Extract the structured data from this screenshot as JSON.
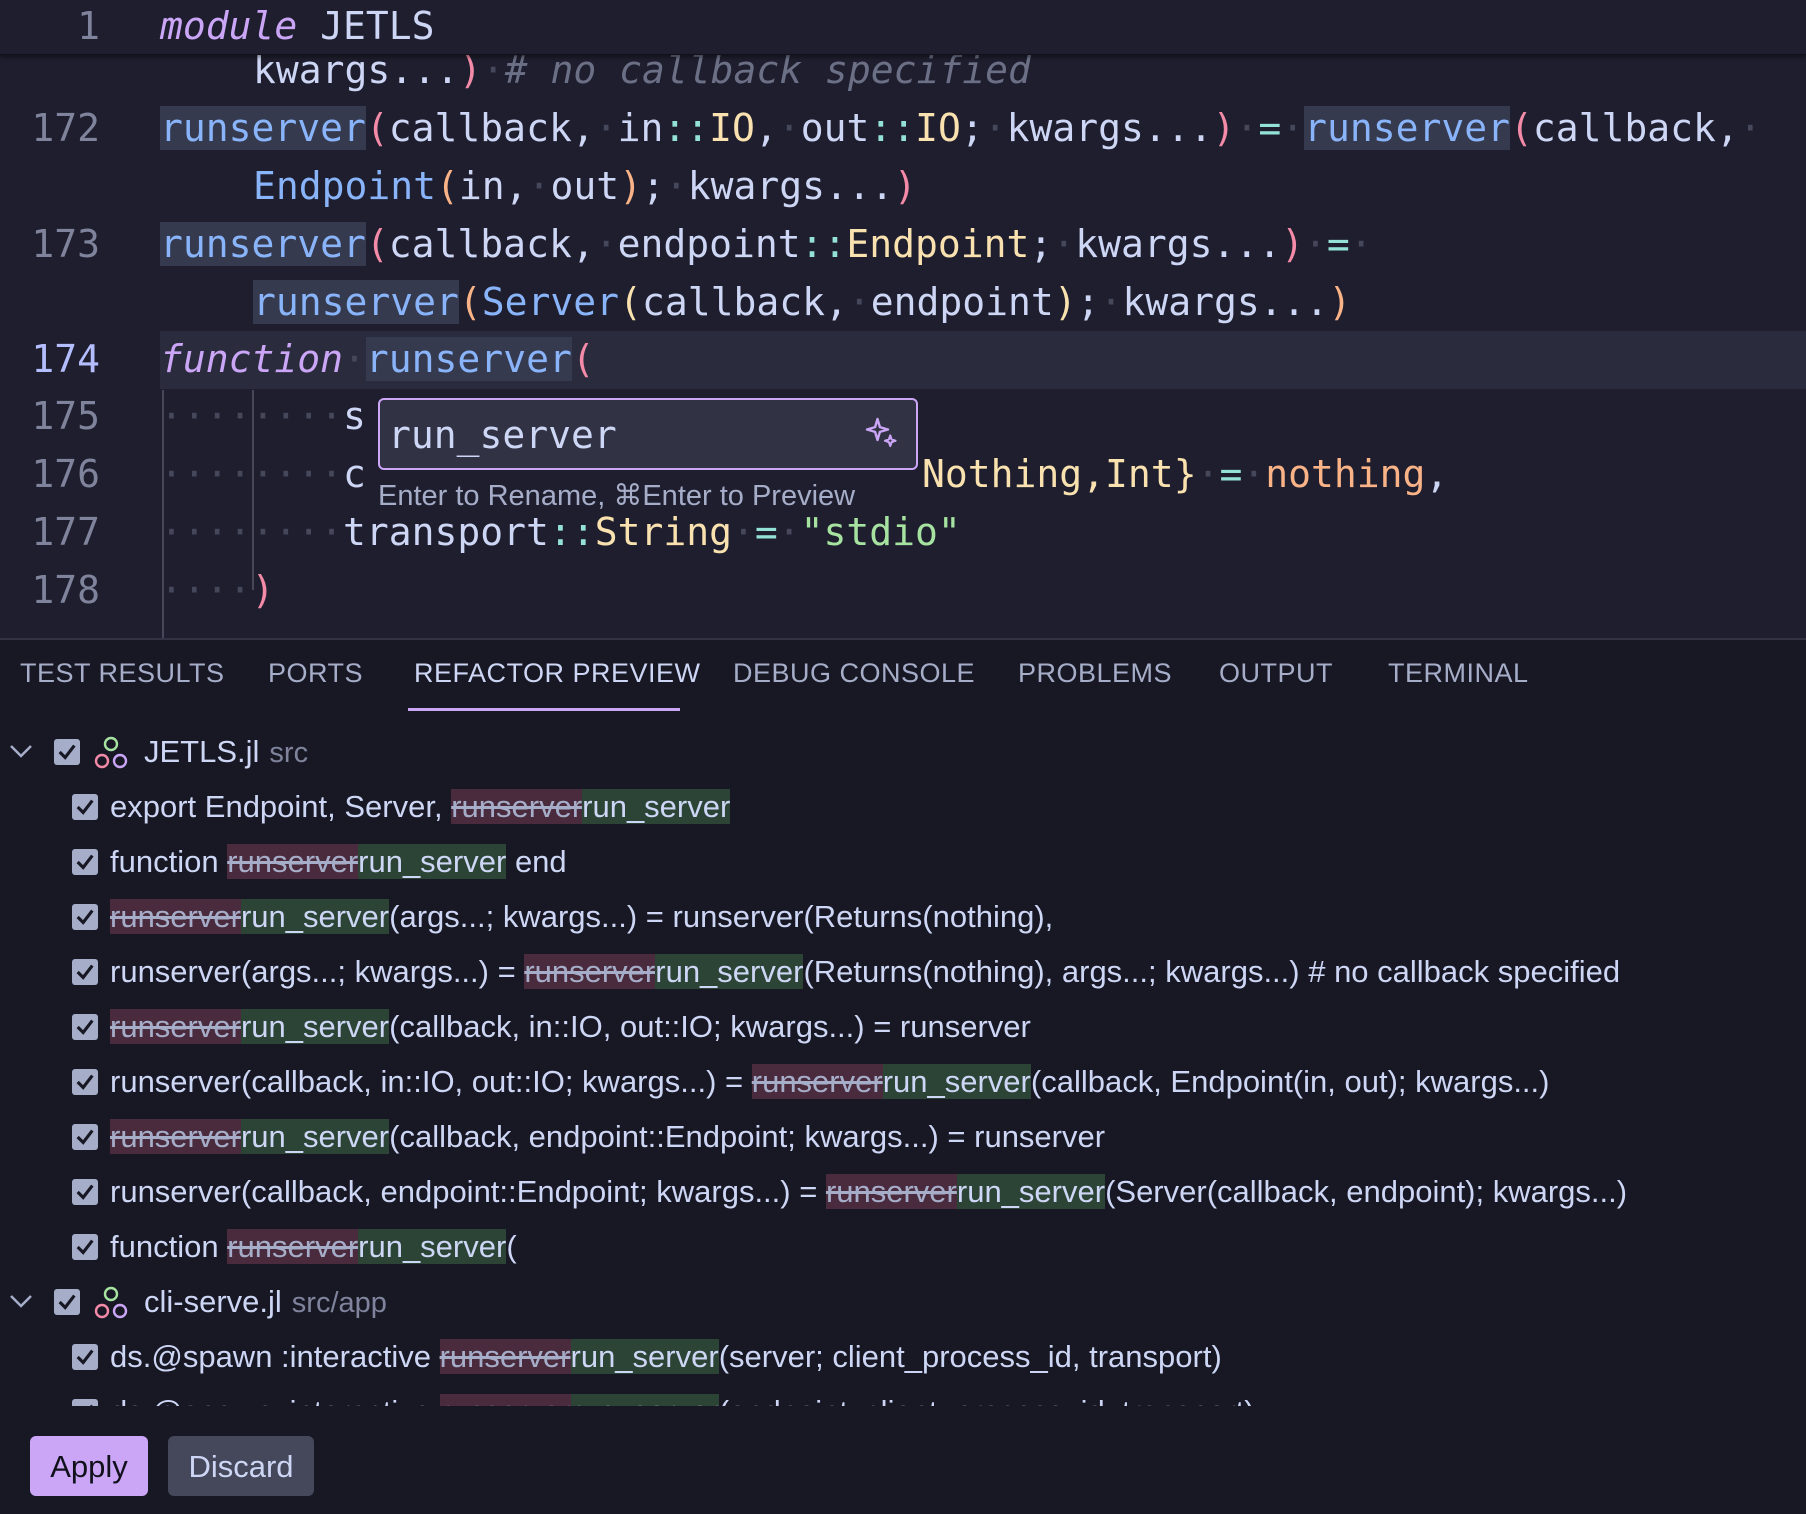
{
  "editor": {
    "sticky_line_number": "1",
    "sticky_keyword": "module",
    "sticky_name": "JETLS",
    "lines": {
      "l0_text": "kwargs...",
      "l0_comment": "# no callback specified",
      "l172_num": "172",
      "l173_num": "173",
      "l174_num": "174",
      "l175_num": "175",
      "l176_num": "176",
      "l177_num": "177",
      "l178_num": "178",
      "fn_name": "runserver",
      "kw_function": "function",
      "callback": "callback",
      "in": "in",
      "out": "out",
      "io": "IO",
      "kwargs": "kwargs...",
      "endpoint_ty": "Endpoint",
      "endpoint": "endpoint",
      "server_ty": "Server",
      "l175_s": "s",
      "l176_c": "c",
      "l176_rest_ty1": "Nothing",
      "l176_rest_ty2": "Int",
      "l176_nothing": "nothing",
      "l177_transport": "transport",
      "l177_type": "String",
      "l177_str": "\"stdio\"",
      "l178_paren": ")"
    }
  },
  "rename": {
    "value": "run_server",
    "hint": "Enter to Rename, ⌘Enter to Preview"
  },
  "panel": {
    "tabs": [
      "TEST RESULTS",
      "PORTS",
      "REFACTOR PREVIEW",
      "DEBUG CONSOLE",
      "PROBLEMS",
      "OUTPUT",
      "TERMINAL"
    ],
    "files": [
      {
        "name": "JETLS.jl",
        "path": "src",
        "changes": [
          {
            "pre": "export Endpoint, Server, ",
            "del": "runserver",
            "ins": "run_server",
            "post": ""
          },
          {
            "pre": "function ",
            "del": "runserver",
            "ins": "run_server",
            "post": " end"
          },
          {
            "pre": "",
            "del": "runserver",
            "ins": "run_server",
            "post": "(args...; kwargs...) = runserver(Returns(nothing),"
          },
          {
            "pre": "runserver(args...; kwargs...) = ",
            "del": "runserver",
            "ins": "run_server",
            "post": "(Returns(nothing), args...; kwargs...) # no callback specified"
          },
          {
            "pre": "",
            "del": "runserver",
            "ins": "run_server",
            "post": "(callback, in::IO, out::IO; kwargs...) = runserver"
          },
          {
            "pre": "runserver(callback, in::IO, out::IO; kwargs...) = ",
            "del": "runserver",
            "ins": "run_server",
            "post": "(callback, Endpoint(in, out); kwargs...)"
          },
          {
            "pre": "",
            "del": "runserver",
            "ins": "run_server",
            "post": "(callback, endpoint::Endpoint; kwargs...) = runserver"
          },
          {
            "pre": "runserver(callback, endpoint::Endpoint; kwargs...) = ",
            "del": "runserver",
            "ins": "run_server",
            "post": "(Server(callback, endpoint); kwargs...)"
          },
          {
            "pre": "function ",
            "del": "runserver",
            "ins": "run_server",
            "post": "("
          }
        ]
      },
      {
        "name": "cli-serve.jl",
        "path": "src/app",
        "changes": [
          {
            "pre": "ds.@spawn :interactive ",
            "del": "runserver",
            "ins": "run_server",
            "post": "(server; client_process_id, transport)"
          },
          {
            "pre": "ds.@spawn :interactive ",
            "del": "runserver",
            "ins": "run_server",
            "post": "(endpoint; client_process_id, transport)"
          }
        ]
      }
    ],
    "apply_label": "Apply",
    "discard_label": "Discard"
  }
}
